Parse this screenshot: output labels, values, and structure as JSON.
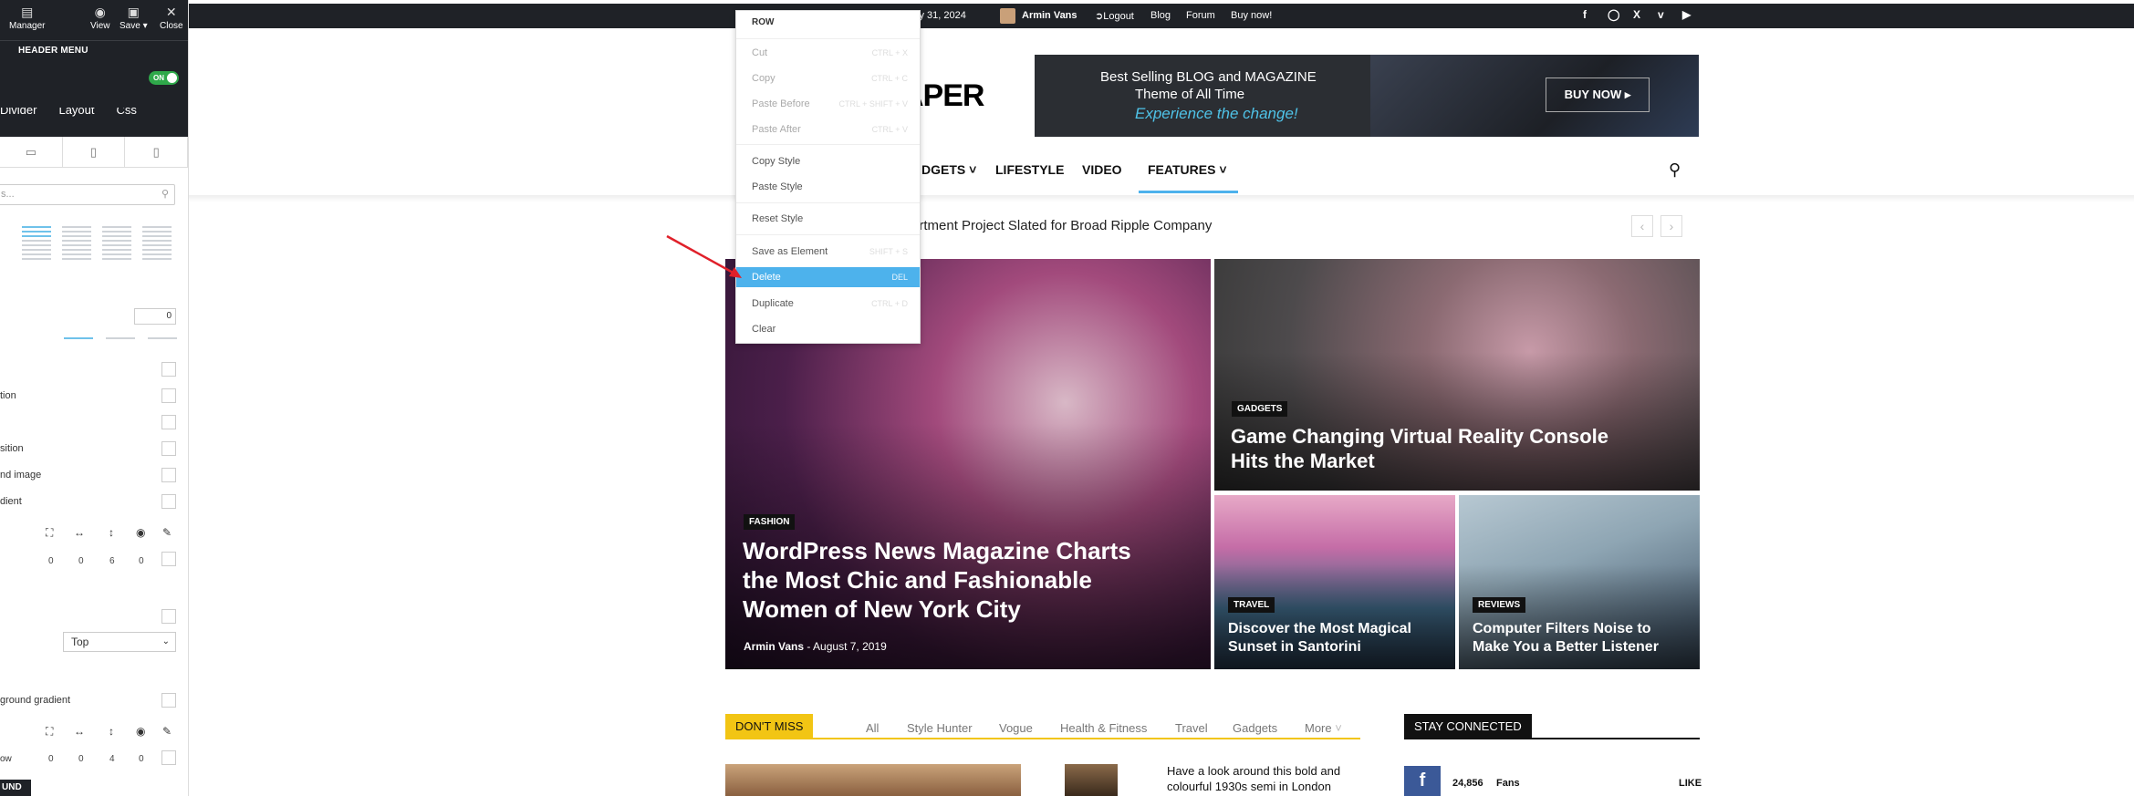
{
  "editor": {
    "toolbar": {
      "manager": "Manager",
      "view": "View",
      "save": "Save ▾",
      "close": "Close"
    },
    "section_label": "HEADER MENU",
    "toggle": "ON",
    "tabs": [
      "Divider",
      "Layout",
      "Css"
    ],
    "search_placeholder": "s...",
    "number_value": "0",
    "labels": {
      "l1": "tion",
      "l2": "sition",
      "l3": "nd image",
      "l4": "dient",
      "l5": "ground gradient",
      "l6": "ow"
    },
    "row1_values": [
      "0",
      "0",
      "6",
      "0"
    ],
    "row2_values": [
      "0",
      "0",
      "4",
      "0"
    ],
    "select_value": "Top",
    "badge": "UND"
  },
  "topbar": {
    "date": "ly 31, 2024",
    "user": "Armin Vans",
    "logout": "Logout",
    "links": [
      "Blog",
      "Forum",
      "Buy now!"
    ],
    "social_icons": [
      "facebook-icon",
      "instagram-icon",
      "x-icon",
      "vimeo-icon",
      "youtube-icon"
    ]
  },
  "header": {
    "logo_fragment": "APER",
    "ad": {
      "line1": "Best Selling BLOG and MAGAZINE",
      "line2": "Theme of All Time",
      "line3": "Experience the change!",
      "button": "BUY NOW ▸"
    },
    "nav": {
      "items": [
        "DGETS",
        "LIFESTYLE",
        "VIDEO",
        "FEATURES"
      ],
      "active": "FEATURES"
    }
  },
  "ticker": {
    "text": "g Apartment Project Slated for Broad Ripple Company"
  },
  "hero": {
    "main": {
      "category": "FASHION",
      "title": "WordPress News Magazine Charts the Most Chic and Fashionable Women of New York City",
      "author": "Armin Vans",
      "date": "August 7, 2019"
    },
    "vr": {
      "category": "GADGETS",
      "title": "Game Changing Virtual Reality Console Hits the Market"
    },
    "travel": {
      "category": "TRAVEL",
      "title": "Discover the Most Magical Sunset in Santorini"
    },
    "reviews": {
      "category": "REVIEWS",
      "title": "Computer Filters Noise to Make You a Better Listener"
    }
  },
  "dont_miss": {
    "label": "DON'T MISS",
    "filters": [
      "All",
      "Style Hunter",
      "Vogue",
      "Health & Fitness",
      "Travel",
      "Gadgets",
      "More"
    ],
    "article_title": "Have a look around this bold and colourful 1930s semi in London"
  },
  "stay_connected": {
    "label": "STAY CONNECTED",
    "fans_count": "24,856",
    "fans_label": "Fans",
    "action": "LIKE"
  },
  "context_menu": {
    "header": "ROW",
    "items": [
      {
        "label": "Cut",
        "shortcut": "CTRL + X",
        "state": "dis"
      },
      {
        "label": "Copy",
        "shortcut": "CTRL + C",
        "state": "dis"
      },
      {
        "label": "Paste Before",
        "shortcut": "CTRL + SHIFT + V",
        "state": "dis"
      },
      {
        "label": "Paste After",
        "shortcut": "CTRL + V",
        "state": "dis"
      },
      {
        "label": "Copy Style",
        "shortcut": "",
        "state": "en"
      },
      {
        "label": "Paste Style",
        "shortcut": "",
        "state": "en"
      },
      {
        "label": "Reset Style",
        "shortcut": "",
        "state": "en"
      },
      {
        "label": "Save as Element",
        "shortcut": "SHIFT + S",
        "state": "en"
      },
      {
        "label": "Delete",
        "shortcut": "DEL",
        "state": "active"
      },
      {
        "label": "Duplicate",
        "shortcut": "CTRL + D",
        "state": "en"
      },
      {
        "label": "Clear",
        "shortcut": "",
        "state": "en"
      }
    ]
  },
  "colors": {
    "accent": "#4db2ec",
    "dont_miss": "#f2c514",
    "dark": "#1f2227",
    "annotation_arrow": "#e0202a"
  }
}
